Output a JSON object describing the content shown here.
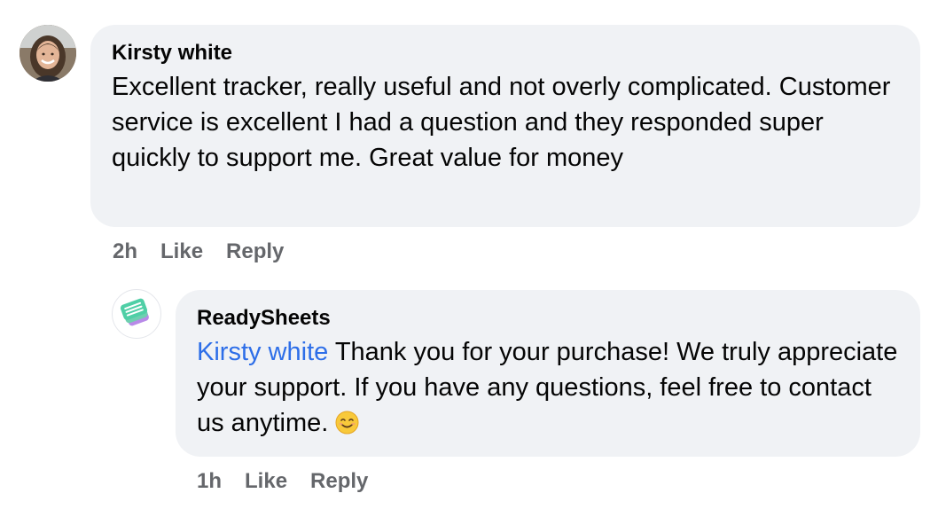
{
  "comment": {
    "author": "Kirsty white",
    "text": "Excellent tracker, really useful and not overly complicated. Customer service is excellent I had a question and they responded super quickly to support me. Great value for money",
    "time": "2h",
    "like_label": "Like",
    "reply_label": "Reply"
  },
  "reply": {
    "author": "ReadySheets",
    "mention": "Kirsty white",
    "text": "Thank you for your purchase! We truly appreciate your support. If you have any questions, feel free to contact us anytime.",
    "emoji": "smiling-face-icon",
    "time": "1h",
    "like_label": "Like",
    "reply_label": "Reply"
  },
  "colors": {
    "bubble": "#f0f2f5",
    "mention": "#2d6ee8",
    "meta": "#65676b",
    "text": "#050505"
  }
}
